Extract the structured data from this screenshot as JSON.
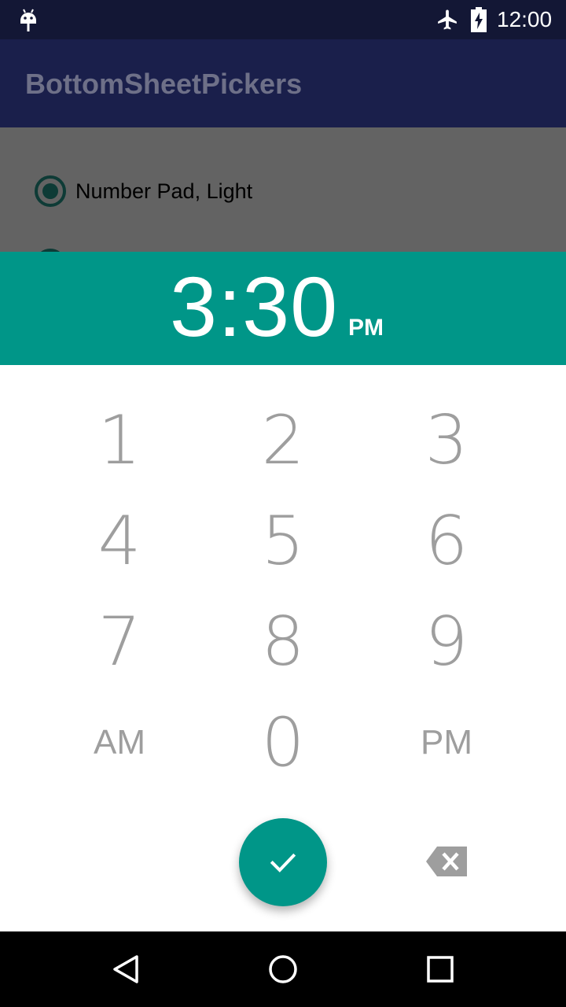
{
  "status_bar": {
    "time": "12:00",
    "icons": [
      "android-icon",
      "airplane-mode-icon",
      "battery-charging-icon"
    ]
  },
  "app_bar": {
    "title": "BottomSheetPickers"
  },
  "content": {
    "radio_options": [
      {
        "label": "Number Pad, Light",
        "selected": true
      }
    ]
  },
  "time_picker": {
    "time": "3:30",
    "ampm": "PM",
    "header_color": "#009688",
    "keys": {
      "k1": "1",
      "k2": "2",
      "k3": "3",
      "k4": "4",
      "k5": "5",
      "k6": "6",
      "k7": "7",
      "k8": "8",
      "k9": "9",
      "am": "AM",
      "k0": "0",
      "pm": "PM"
    },
    "confirm_icon": "check-icon",
    "backspace_icon": "backspace-icon"
  },
  "nav_bar": {
    "icons": [
      "back-icon",
      "home-icon",
      "recents-icon"
    ]
  }
}
